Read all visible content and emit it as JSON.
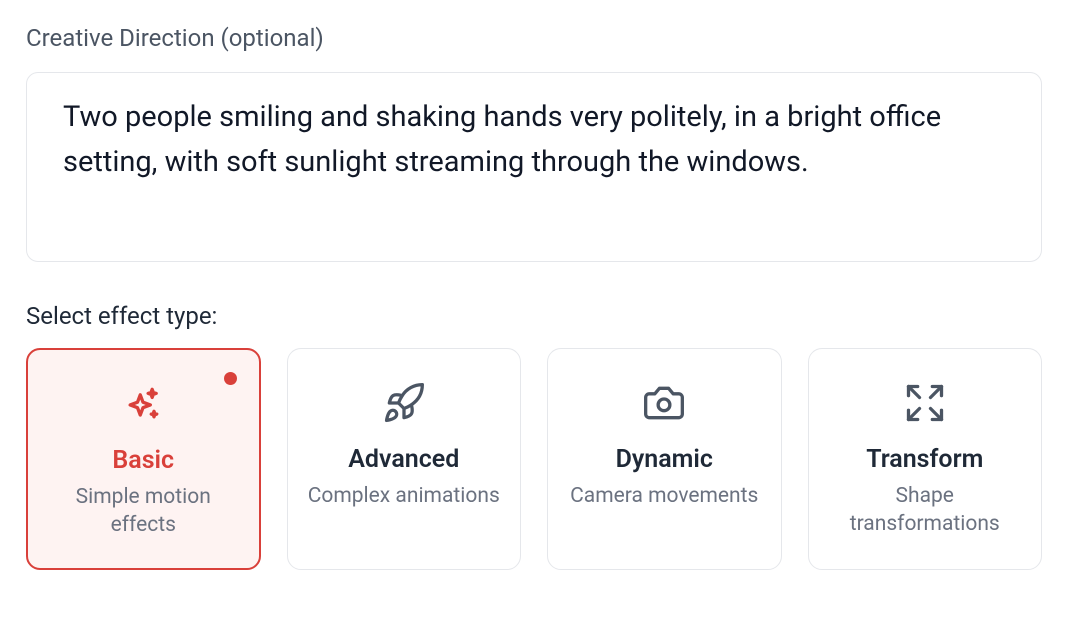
{
  "creativeDirection": {
    "label": "Creative Direction (optional)",
    "value": "Two people smiling and shaking hands very politely, in a bright office setting, with soft sunlight streaming through the windows."
  },
  "effectType": {
    "label": "Select effect type:",
    "selected": "basic",
    "options": [
      {
        "key": "basic",
        "title": "Basic",
        "desc": "Simple motion effects",
        "icon": "sparkles"
      },
      {
        "key": "advanced",
        "title": "Advanced",
        "desc": "Complex animations",
        "icon": "rocket"
      },
      {
        "key": "dynamic",
        "title": "Dynamic",
        "desc": "Camera movements",
        "icon": "camera"
      },
      {
        "key": "transform",
        "title": "Transform",
        "desc": "Shape transformations",
        "icon": "expand"
      }
    ]
  }
}
